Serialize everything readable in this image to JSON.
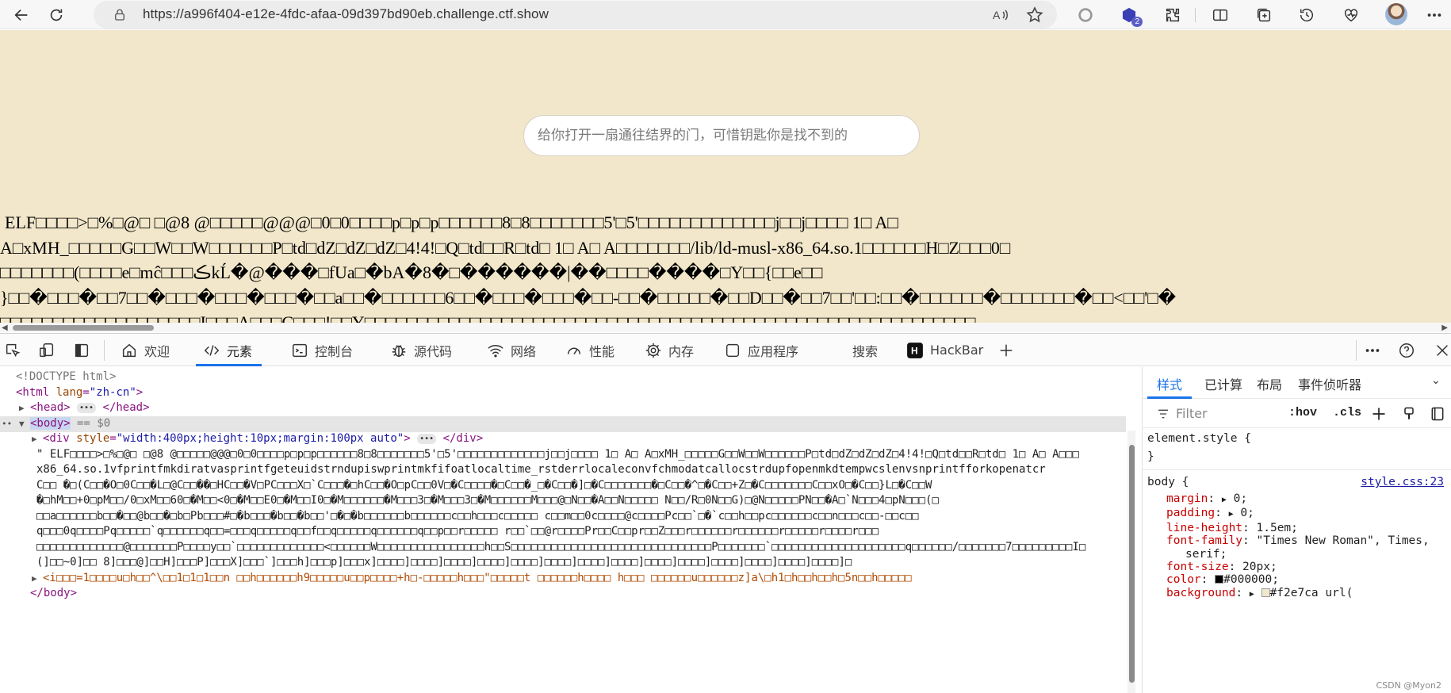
{
  "browser": {
    "url": "https://a996f404-e12e-4fdc-afaa-09d397bd90eb.challenge.ctf.show",
    "extension_badge": "2"
  },
  "page": {
    "search_placeholder": "给你打开一扇通往结界的门，可惜钥匙你是找不到的",
    "binary_lines": [
      " ELF□□□□>□%□@□  □@8 @□□□□□@@@□0□0□□□□p□p□p□□□□□□8□8□□□□□□□5'□5'□□□□□□□□□□□□□j□□j□□□□ 1□ A□",
      "A□xMH_□□□□□G□□W□□W□□□□□□P□td□dZ□dZ□dZ□4!4!□Q□td□□R□td□ 1□ A□ A□□□□□□□/lib/ld-musl-x86_64.so.1□□□□□□H□Z□□□0□",
      "□□□□□□□(□□□□e□mĉ□□□ڪkĹ�@���□fUa□�bA�8�□������|��□□□□����□Y□□{□□e□□",
      "}□□�□□□�□□7□□�□□□�□□□�□□□�□□a□□�□□□□□□6□□�□□□�□□□�□□-□□�□□□□□�□□D□□�□□7□□'□□:□□�□□□□□□�□□□□□□□�□□<□□'□�",
      "□□□□□□□□□□□□□□□□□□□I□□□A□□□C□□□!□□Y□□□□□□□□□□□□□□□□□□□□□□□□□□□□□□□□□□□□□□□□□□□□□□□□□□□□□□□□□□"
    ]
  },
  "devtools": {
    "tabs": [
      {
        "label": "欢迎"
      },
      {
        "label": "元素"
      },
      {
        "label": "控制台"
      },
      {
        "label": "源代码"
      },
      {
        "label": "网络"
      },
      {
        "label": "性能"
      },
      {
        "label": "内存"
      },
      {
        "label": "应用程序"
      },
      {
        "label": "搜索"
      },
      {
        "label": "HackBar"
      }
    ],
    "dom": {
      "doctype": "<!DOCTYPE html>",
      "html_open": "<html",
      "html_lang_attr": "lang",
      "html_lang_val": "\"zh-cn\"",
      "head_open": "<head>",
      "head_close": "</head>",
      "body_open": "<body>",
      "body_eq": " == $0",
      "div_open": "<div",
      "div_style_attr": "style",
      "div_style_val": "\"width:400px;height:10px;margin:100px auto\"",
      "div_close": "</div>",
      "text_lines": [
        "\"  ELF□□□□>□%□@□ □@8 @□□□□□@@@□0□0□□□□p□p□p□□□□□□8□8□□□□□□□5'□5'□□□□□□□□□□□□□j□□j□□□□ 1□ A□ A□xMH_□□□□□G□□W□□W□□□□□□P□td□dZ□dZ□dZ□4!4!□Q□td□□R□td□ 1□ A□ A□□□",
        "x86_64.so.1vfprintfmkdiratvasprintfgeteuidstrndupiswprintmkfifoatlocaltime_rstderrlocaleconvfchmodatcallocstrdupfopenmkdtempwcslenvsnprintfforkopenatcr",
        "C□□  �□(C□□�O□0C□□�L□@C□□��□HC□□�V□PC□□□X□`C□□□�□hC□□�O□pC□□0V□�C□□□□�□C□□�_□�C□□�]□�C□□□□□□□�□C□□�^□�C□□+Z□�C□□□□□□□C□□xO□�C□□}L□�C□□W",
        "�□hM□□+0□pM□□/0□xM□□60□�M□□<0□�M□□E0□�M□□I0□�M□□□□□□�M□□□3□�M□□□3□�M□□□□□□M□□□@□N□□�A□□N□□□□□ N□□/R□0N□□G)□@N□□□□□PN□□�A□`N□□□4□pN□□□(□",
        "□□a□□□□□□b□□�□□@b□□�□b□Pb□□□#□�b□□□�b□□�b□□'□�□�b□□□□□□b□□□□□□c□□h□□□c□□□□□ c□□m□□0c□□□□@c□□□□Pc□□`□�`c□□h□□pc□□□□□□c□□n□□□c□□-□□c□□",
        "q□□□0q□□□□Pq□□□□□`q□□□□□□q□□=□□□q□□□□□q□□f□□q□□□□□q□□□□□□q□□p□□r□□□□□  r□□`□□@r□□□□Pr□□C□□pr□□Z□□□r□□□□□□r□□□□□□r□□□□□r□□□□r□□□",
        "□□□□□□□□□□□□□@□□□□□□□P□□□□y□□`□□□□□□□□□□□□□<□□□□□□W□□□□□□□□□□□□□□□□h□□S□□□□□□□□□□□□□□□□□□□□□□□□□□□□□□P□□□□□□□`□□□□□□□□□□□□□□□□□□□□q□□□□□□/□□□□□□□7□□□□□□□□□I□",
        "(]□□~0]□□ 8]□□□@]□□H]□□□P]□□□X]□□□`]□□□h]□□□p]□□□x]□□□□]□□□□]□□□□]□□□□]□□□□]□□□□]□□□□]□□□□]□□□□]□□□□]□□□□]□□□□]□□□□]□□□□]□"
      ],
      "i_line": "<i□□□=1□□□□u□h□□^\\□□1□1□1□□n  □□h□□□□□□h9□□□□□u□□p□□□□+h□-□□□□□h□□□\"□□□□□t  □□□□□□h□□□□  h□□□  □□□□□□u□□□□□□z]a\\□h1□h□□h□□h□5n□□h□□□□□",
      "body_close": "</body>"
    },
    "styles_tabs": [
      "样式",
      "已计算",
      "布局",
      "事件侦听器"
    ],
    "filter_placeholder": "Filter",
    "hov_label": ":hov",
    "cls_label": ".cls",
    "rules": {
      "element_style_open": "element.style {",
      "element_style_close": "}",
      "body_selector": "body {",
      "body_source": "style.css:23",
      "props": [
        {
          "name": "margin",
          "value": "0;",
          "arrow": true
        },
        {
          "name": "padding",
          "value": "0;",
          "arrow": true
        },
        {
          "name": "line-height",
          "value": "1.5em;",
          "arrow": false
        },
        {
          "name": "font-family",
          "value": "\"Times New Roman\", Times,",
          "arrow": false
        },
        {
          "name": "",
          "value": "serif;",
          "arrow": false
        },
        {
          "name": "font-size",
          "value": "20px;",
          "arrow": false
        },
        {
          "name": "color",
          "value": "#000000;",
          "arrow": false,
          "swatch": "#000000"
        },
        {
          "name": "background",
          "value": "#f2e7ca url(",
          "arrow": true,
          "swatch": "#f2e7ca"
        }
      ]
    },
    "watermark": "CSDN @Myon⁠2"
  },
  "colors": {
    "page_background": "#f2e7ca",
    "accent": "#1a73e8",
    "tag": "#881280",
    "attr_name": "#994500",
    "attr_value": "#1a1aa6",
    "css_prop": "#c80000"
  }
}
